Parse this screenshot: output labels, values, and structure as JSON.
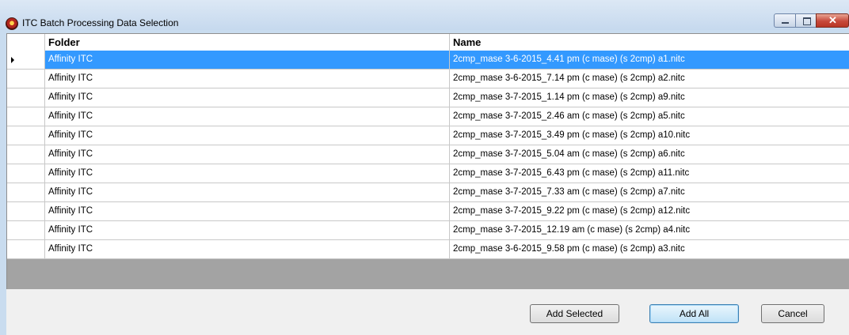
{
  "window": {
    "title": "ITC Batch Processing Data Selection",
    "icon": "app-logo-icon",
    "controls": {
      "minimize": "minimize-icon",
      "maximize": "maximize-icon",
      "close": "close-icon"
    }
  },
  "grid": {
    "columns": [
      "Folder",
      "Name"
    ],
    "selected_index": 0,
    "rows": [
      {
        "folder": "Affinity ITC",
        "name": "2cmp_mase 3-6-2015_4.41 pm (c mase) (s 2cmp) a1.nitc"
      },
      {
        "folder": "Affinity ITC",
        "name": "2cmp_mase 3-6-2015_7.14 pm (c mase) (s 2cmp) a2.nitc"
      },
      {
        "folder": "Affinity ITC",
        "name": "2cmp_mase 3-7-2015_1.14 pm (c mase) (s 2cmp) a9.nitc"
      },
      {
        "folder": "Affinity ITC",
        "name": "2cmp_mase 3-7-2015_2.46 am (c mase) (s 2cmp) a5.nitc"
      },
      {
        "folder": "Affinity ITC",
        "name": "2cmp_mase 3-7-2015_3.49 pm (c mase) (s 2cmp) a10.nitc"
      },
      {
        "folder": "Affinity ITC",
        "name": "2cmp_mase 3-7-2015_5.04 am (c mase) (s 2cmp) a6.nitc"
      },
      {
        "folder": "Affinity ITC",
        "name": "2cmp_mase 3-7-2015_6.43 pm (c mase) (s 2cmp) a11.nitc"
      },
      {
        "folder": "Affinity ITC",
        "name": "2cmp_mase 3-7-2015_7.33 am (c mase) (s 2cmp) a7.nitc"
      },
      {
        "folder": "Affinity ITC",
        "name": "2cmp_mase 3-7-2015_9.22 pm (c mase) (s 2cmp) a12.nitc"
      },
      {
        "folder": "Affinity ITC",
        "name": "2cmp_mase 3-7-2015_12.19 am (c mase) (s 2cmp) a4.nitc"
      },
      {
        "folder": "Affinity ITC",
        "name": "2cmp_mase 3-6-2015_9.58 pm (c mase) (s 2cmp) a3.nitc"
      }
    ]
  },
  "buttons": {
    "add_selected": "Add Selected",
    "add_all": "Add All",
    "cancel": "Cancel"
  },
  "colors": {
    "selection": "#3399ff",
    "empty_grid": "#a3a3a3",
    "frame": "#c9dcef"
  }
}
